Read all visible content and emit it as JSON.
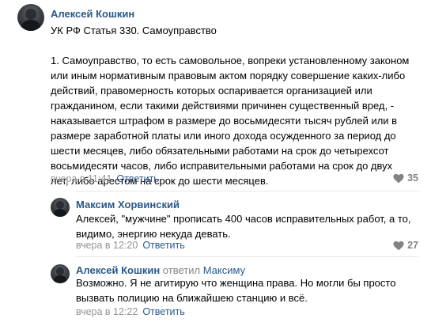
{
  "comments": [
    {
      "author": "Алексей Кошкин",
      "text_lines": [
        "УК РФ Статья 330. Самоуправство"
      ],
      "text_lines_2": [
        "1. Самоуправство, то есть самовольное, вопреки установленному законом",
        "или иным нормативным правовым актом порядку совершение каких-либо",
        "действий, правомерность которых оспаривается организацией или",
        "гражданином, если такими действиями причинен существенный вред, -",
        "наказывается штрафом в размере до восьмидесяти тысяч рублей или в",
        "размере заработной платы или иного дохода осужденного за период до",
        "шести месяцев, либо обязательными работами на срок до четырехсот",
        "восьмидесяти часов, либо исправительными работами на срок до двух",
        "лет, либо арестом на срок до шести месяцев."
      ],
      "time": "вчера в 11:41",
      "reply_label": "Ответить",
      "likes": "35"
    },
    {
      "author": "Максим Хорвинский",
      "text_lines": [
        "Алексей, \"мужчине\" прописать 400 часов исправительных работ, а то,",
        "видимо, энергию некуда девать."
      ],
      "time": "вчера в 12:20",
      "reply_label": "Ответить",
      "likes": "27"
    },
    {
      "author": "Алексей Кошкин",
      "replied_prefix": "ответил",
      "replied_to": "Максиму",
      "text_lines": [
        "Возможно. Я не агитирую что женщина права. Но могли бы просто",
        "вызвать полицию на ближайшею станцию и всё."
      ],
      "time": "вчера в 12:22",
      "reply_label": "Ответить"
    }
  ],
  "colors": {
    "link": "#2a5885",
    "meta": "#939393",
    "likes": "#828282",
    "divider": "#e7e8ec"
  },
  "icons": {
    "like": "heart-icon"
  }
}
